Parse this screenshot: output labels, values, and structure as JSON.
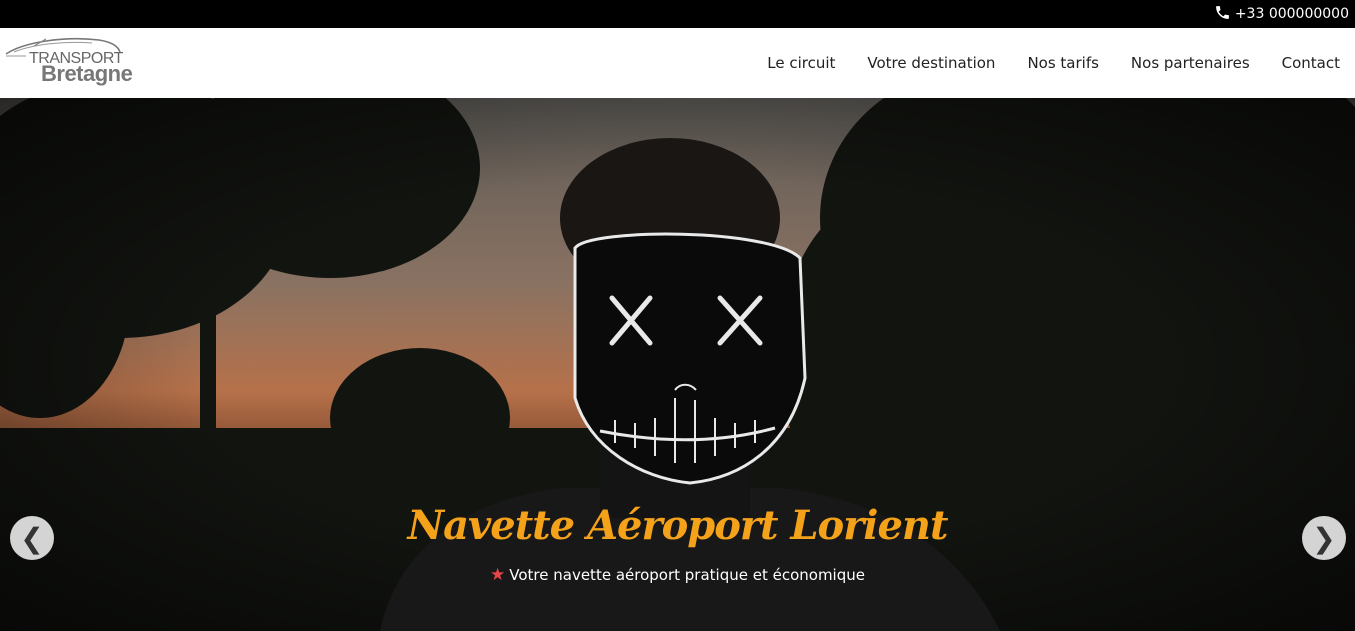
{
  "topbar": {
    "phone": "+33 000000000"
  },
  "logo": {
    "line1": "TRANSPORT",
    "line2": "Bretagne"
  },
  "nav": [
    {
      "label": "Le circuit"
    },
    {
      "label": "Votre destination"
    },
    {
      "label": "Nos tarifs"
    },
    {
      "label": "Nos partenaires"
    },
    {
      "label": "Contact"
    }
  ],
  "hero": {
    "title": "Navette Aéroport Lorient",
    "subtitle": "Votre navette aéroport pratique et économique",
    "prev_arrow": "❮",
    "next_arrow": "❯"
  },
  "colors": {
    "accent": "#f5a21b",
    "star": "#e8454b",
    "topbar": "#000000"
  }
}
